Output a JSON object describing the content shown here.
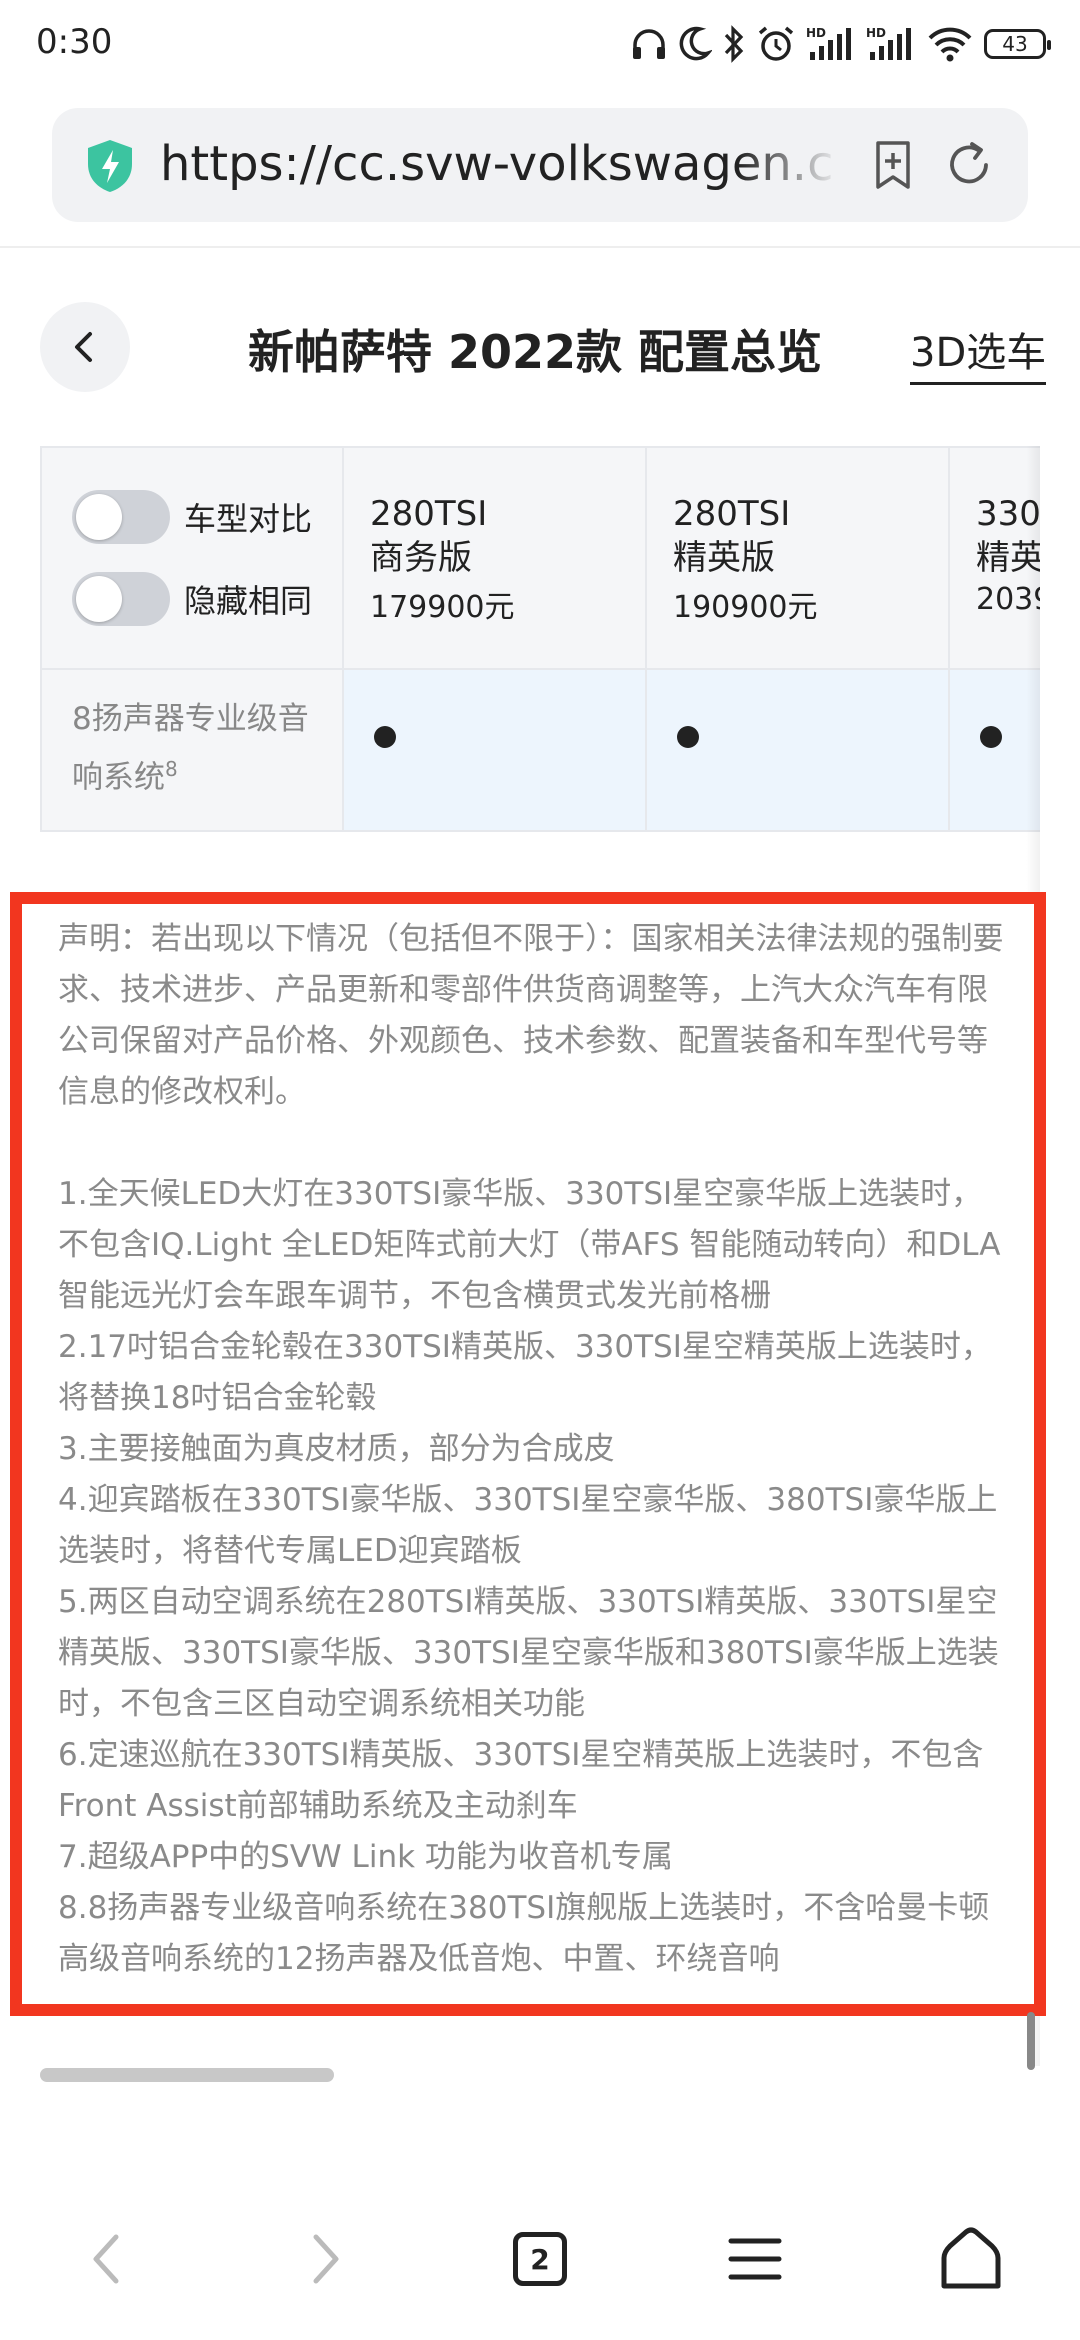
{
  "status": {
    "time": "0:30",
    "battery": "43",
    "icons": [
      "headphones-icon",
      "moon-icon",
      "bluetooth-icon",
      "alarm-icon",
      "hd-signal-icon",
      "hd-signal-icon",
      "wifi-icon",
      "battery-icon"
    ]
  },
  "browser": {
    "url": "https://cc.svw-volkswagen.c",
    "tab_count": "2",
    "accent": "#3cc4a0"
  },
  "header": {
    "title": "新帕萨特 2022款 配置总览",
    "link_3d": "3D选车"
  },
  "table": {
    "toggles": [
      {
        "label": "车型对比",
        "on": false
      },
      {
        "label": "隐藏相同",
        "on": false
      }
    ],
    "models": [
      {
        "name": "280TSI\n商务版",
        "price": "179900元"
      },
      {
        "name": "280TSI\n精英版",
        "price": "190900元"
      },
      {
        "name": "330\n精英",
        "price": "2039"
      }
    ],
    "feature": {
      "label": "8扬声器专业级音响系统",
      "note": "8",
      "marks": [
        "●",
        "●",
        "●"
      ]
    }
  },
  "disclaimer": {
    "border_color": "#f2361f",
    "intro": "声明：若出现以下情况（包括但不限于）：国家相关法律法规的强制要求、技术进步、产品更新和零部件供货商调整等，上汽大众汽车有限公司保留对产品价格、外观颜色、技术参数、配置装备和车型代号等信息的修改权利。",
    "notes": [
      "1.全天候LED大灯在330TSI豪华版、330TSI星空豪华版上选装时，不包含IQ.Light 全LED矩阵式前大灯（带AFS 智能随动转向）和DLA智能远光灯会车跟车调节，不包含横贯式发光前格栅",
      "2.17吋铝合金轮毂在330TSI精英版、330TSI星空精英版上选装时，将替换18吋铝合金轮毂",
      "3.主要接触面为真皮材质，部分为合成皮",
      "4.迎宾踏板在330TSI豪华版、330TSI星空豪华版、380TSI豪华版上选装时，将替代专属LED迎宾踏板",
      "5.两区自动空调系统在280TSI精英版、330TSI精英版、330TSI星空精英版、330TSI豪华版、330TSI星空豪华版和380TSI豪华版上选装时，不包含三区自动空调系统相关功能",
      "6.定速巡航在330TSI精英版、330TSI星空精英版上选装时，不包含Front Assist前部辅助系统及主动刹车",
      "7.超级APP中的SVW Link 功能为收音机专属",
      "8.8扬声器专业级音响系统在380TSI旗舰版上选装时，不含哈曼卡顿高级音响系统的12扬声器及低音炮、中置、环绕音响"
    ]
  },
  "navbar": {
    "items": [
      "back-icon",
      "forward-icon",
      "tabs-icon",
      "menu-icon",
      "home-icon"
    ]
  }
}
